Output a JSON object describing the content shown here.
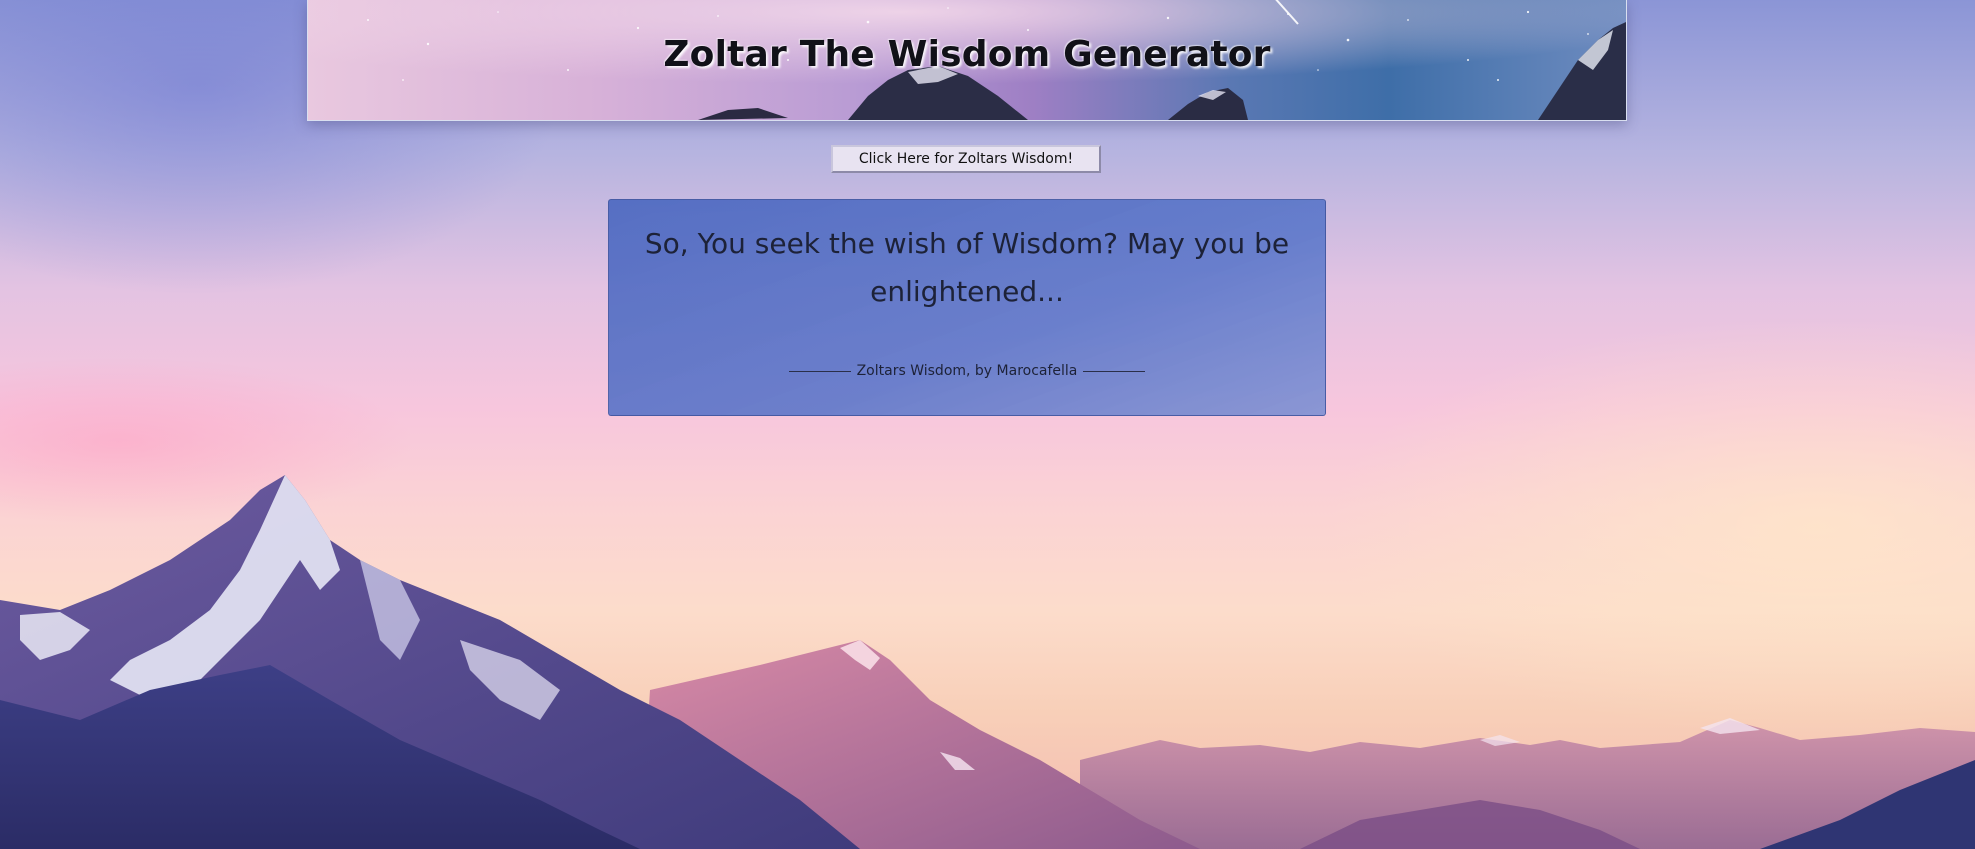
{
  "header": {
    "title": "Zoltar The Wisdom Generator"
  },
  "action": {
    "button_label": "Click Here for Zoltars Wisdom!"
  },
  "wisdom": {
    "message": "So, You seek the wish of Wisdom? May you be enlightened...",
    "credit": "Zoltars Wisdom, by Marocafella"
  },
  "colors": {
    "card": "#5a78c6",
    "sky_top": "#8b95d6",
    "sky_bottom": "#f8cfb8"
  }
}
